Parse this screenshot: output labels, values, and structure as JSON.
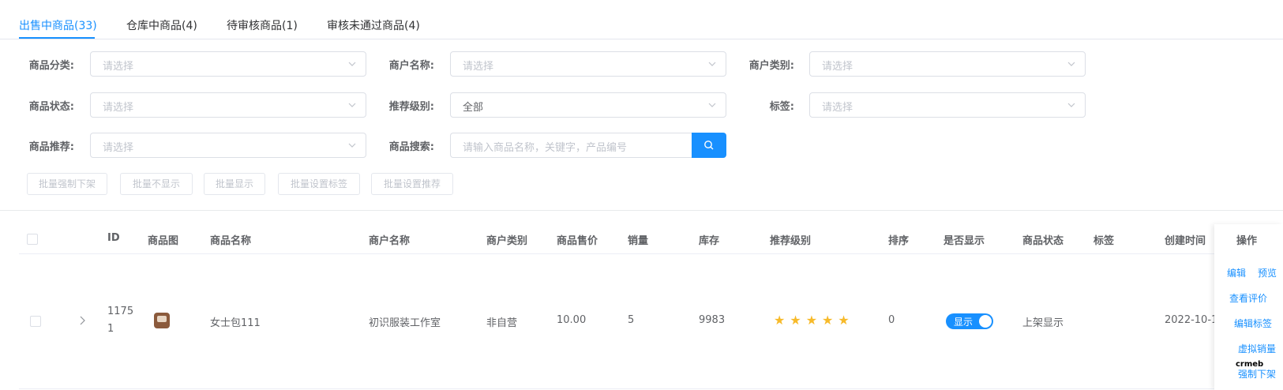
{
  "tabs": [
    {
      "label": "出售中商品(33)"
    },
    {
      "label": "仓库中商品(4)"
    },
    {
      "label": "待审核商品(1)"
    },
    {
      "label": "审核未通过商品(4)"
    }
  ],
  "filters": {
    "category": {
      "label": "商品分类:",
      "placeholder": "请选择"
    },
    "merchant_name": {
      "label": "商户名称:",
      "placeholder": "请选择"
    },
    "merchant_type": {
      "label": "商户类别:",
      "placeholder": "请选择"
    },
    "status": {
      "label": "商品状态:",
      "placeholder": "请选择"
    },
    "recommend_level": {
      "label": "推荐级别:",
      "value": "全部"
    },
    "tag": {
      "label": "标签:",
      "placeholder": "请选择"
    },
    "recommend": {
      "label": "商品推荐:",
      "placeholder": "请选择"
    },
    "search": {
      "label": "商品搜索:",
      "placeholder": "请输入商品名称，关键字，产品编号"
    }
  },
  "batch_buttons": [
    "批量强制下架",
    "批量不显示",
    "批量显示",
    "批量设置标签",
    "批量设置推荐"
  ],
  "table": {
    "headers": {
      "id": "ID",
      "image": "商品图",
      "name": "商品名称",
      "merchant": "商户名称",
      "merchant_type": "商户类别",
      "price": "商品售价",
      "sales": "销量",
      "stock": "库存",
      "recommend_level": "推荐级别",
      "sort": "排序",
      "show": "是否显示",
      "status": "商品状态",
      "tag": "标签",
      "created": "创建时间",
      "ops": "操作"
    },
    "row": {
      "id_line1": "1175",
      "id_line2": "1",
      "name": "女士包111",
      "merchant": "初识服装工作室",
      "merchant_type": "非自营",
      "price": "10.00",
      "sales": "5",
      "stock": "9983",
      "stars": 5,
      "sort": "0",
      "show_label": "显示",
      "status": "上架显示",
      "created": "2022-10-1"
    },
    "ops": {
      "edit": "编辑",
      "preview": "预览",
      "reviews": "查看评价",
      "edit_tag": "编辑标签",
      "virtual_sales": "虚拟销量",
      "force_off": "强制下架"
    }
  },
  "logo_text": "crmeb",
  "colors": {
    "accent": "#1890ff",
    "star": "#f7ba2a"
  }
}
